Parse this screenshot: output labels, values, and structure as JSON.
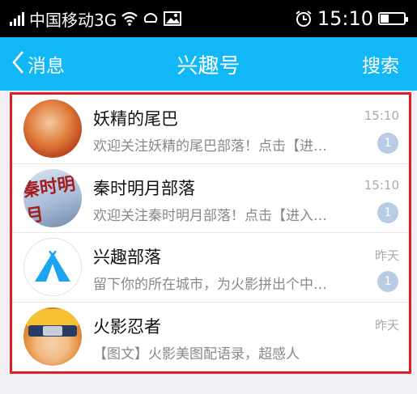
{
  "status_bar": {
    "carrier": "中国移动3G",
    "time": "15:10"
  },
  "nav": {
    "back_label": "消息",
    "title": "兴趣号",
    "search_label": "搜索"
  },
  "items": [
    {
      "title": "妖精的尾巴",
      "preview": "欢迎关注妖精的尾巴部落！点击【进…",
      "time": "15:10",
      "badge": "1"
    },
    {
      "title": "秦时明月部落",
      "preview": "欢迎关注秦时明月部落！点击【进入…",
      "time": "15:10",
      "badge": "1",
      "avatar_text": "秦时明月"
    },
    {
      "title": "兴趣部落",
      "preview": "留下你的所在城市，为火影拼出个中…",
      "time": "昨天",
      "badge": "1"
    },
    {
      "title": "火影忍者",
      "preview": "【图文】火影美图配语录，超感人",
      "time": "昨天"
    }
  ],
  "colors": {
    "nav_background": "#12b7f5",
    "highlight_border": "#e02020",
    "badge": "#b8cde3"
  }
}
